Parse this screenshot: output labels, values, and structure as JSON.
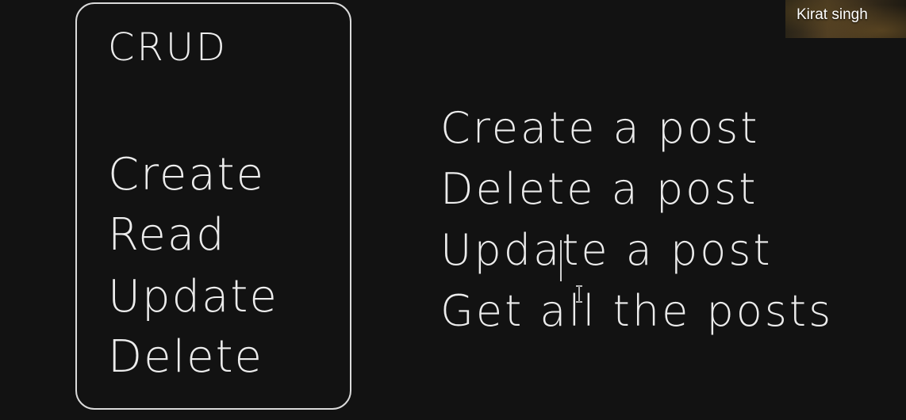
{
  "slide": {
    "box": {
      "title": "CRUD",
      "items": [
        "Create",
        "Read",
        "Update",
        "Delete"
      ]
    },
    "operations": [
      "Create a post",
      "Delete a post",
      "Update a post",
      "Get all the posts"
    ]
  },
  "video_call": {
    "participant_name": "Kirat singh"
  },
  "colors": {
    "background": "#121212",
    "ink": "#ececec"
  },
  "icons": {
    "cursor": "text-ibeam-cursor"
  }
}
